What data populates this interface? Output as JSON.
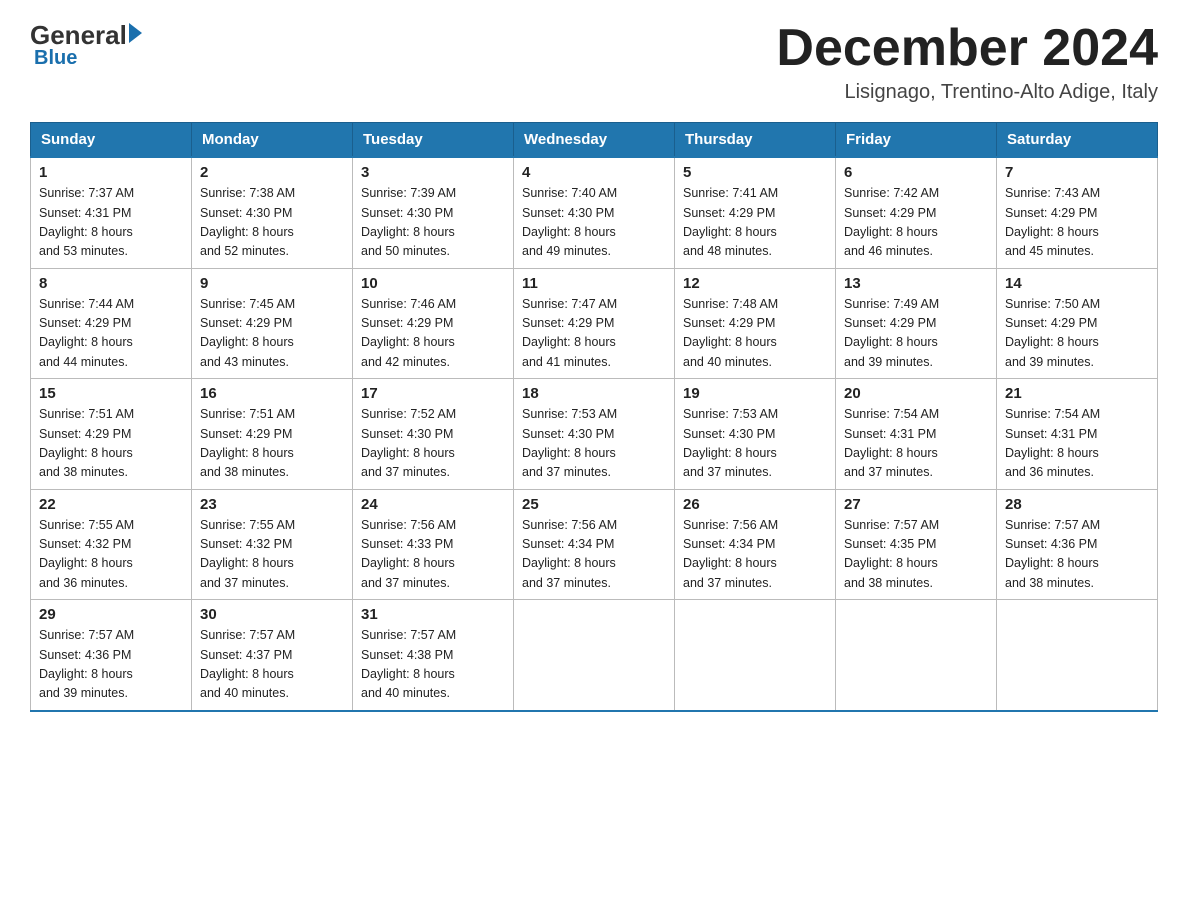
{
  "header": {
    "logo_general": "General",
    "logo_blue": "Blue",
    "title": "December 2024",
    "subtitle": "Lisignago, Trentino-Alto Adige, Italy"
  },
  "days_of_week": [
    "Sunday",
    "Monday",
    "Tuesday",
    "Wednesday",
    "Thursday",
    "Friday",
    "Saturday"
  ],
  "weeks": [
    [
      {
        "date": "1",
        "sunrise": "7:37 AM",
        "sunset": "4:31 PM",
        "daylight": "8 hours and 53 minutes."
      },
      {
        "date": "2",
        "sunrise": "7:38 AM",
        "sunset": "4:30 PM",
        "daylight": "8 hours and 52 minutes."
      },
      {
        "date": "3",
        "sunrise": "7:39 AM",
        "sunset": "4:30 PM",
        "daylight": "8 hours and 50 minutes."
      },
      {
        "date": "4",
        "sunrise": "7:40 AM",
        "sunset": "4:30 PM",
        "daylight": "8 hours and 49 minutes."
      },
      {
        "date": "5",
        "sunrise": "7:41 AM",
        "sunset": "4:29 PM",
        "daylight": "8 hours and 48 minutes."
      },
      {
        "date": "6",
        "sunrise": "7:42 AM",
        "sunset": "4:29 PM",
        "daylight": "8 hours and 46 minutes."
      },
      {
        "date": "7",
        "sunrise": "7:43 AM",
        "sunset": "4:29 PM",
        "daylight": "8 hours and 45 minutes."
      }
    ],
    [
      {
        "date": "8",
        "sunrise": "7:44 AM",
        "sunset": "4:29 PM",
        "daylight": "8 hours and 44 minutes."
      },
      {
        "date": "9",
        "sunrise": "7:45 AM",
        "sunset": "4:29 PM",
        "daylight": "8 hours and 43 minutes."
      },
      {
        "date": "10",
        "sunrise": "7:46 AM",
        "sunset": "4:29 PM",
        "daylight": "8 hours and 42 minutes."
      },
      {
        "date": "11",
        "sunrise": "7:47 AM",
        "sunset": "4:29 PM",
        "daylight": "8 hours and 41 minutes."
      },
      {
        "date": "12",
        "sunrise": "7:48 AM",
        "sunset": "4:29 PM",
        "daylight": "8 hours and 40 minutes."
      },
      {
        "date": "13",
        "sunrise": "7:49 AM",
        "sunset": "4:29 PM",
        "daylight": "8 hours and 39 minutes."
      },
      {
        "date": "14",
        "sunrise": "7:50 AM",
        "sunset": "4:29 PM",
        "daylight": "8 hours and 39 minutes."
      }
    ],
    [
      {
        "date": "15",
        "sunrise": "7:51 AM",
        "sunset": "4:29 PM",
        "daylight": "8 hours and 38 minutes."
      },
      {
        "date": "16",
        "sunrise": "7:51 AM",
        "sunset": "4:29 PM",
        "daylight": "8 hours and 38 minutes."
      },
      {
        "date": "17",
        "sunrise": "7:52 AM",
        "sunset": "4:30 PM",
        "daylight": "8 hours and 37 minutes."
      },
      {
        "date": "18",
        "sunrise": "7:53 AM",
        "sunset": "4:30 PM",
        "daylight": "8 hours and 37 minutes."
      },
      {
        "date": "19",
        "sunrise": "7:53 AM",
        "sunset": "4:30 PM",
        "daylight": "8 hours and 37 minutes."
      },
      {
        "date": "20",
        "sunrise": "7:54 AM",
        "sunset": "4:31 PM",
        "daylight": "8 hours and 37 minutes."
      },
      {
        "date": "21",
        "sunrise": "7:54 AM",
        "sunset": "4:31 PM",
        "daylight": "8 hours and 36 minutes."
      }
    ],
    [
      {
        "date": "22",
        "sunrise": "7:55 AM",
        "sunset": "4:32 PM",
        "daylight": "8 hours and 36 minutes."
      },
      {
        "date": "23",
        "sunrise": "7:55 AM",
        "sunset": "4:32 PM",
        "daylight": "8 hours and 37 minutes."
      },
      {
        "date": "24",
        "sunrise": "7:56 AM",
        "sunset": "4:33 PM",
        "daylight": "8 hours and 37 minutes."
      },
      {
        "date": "25",
        "sunrise": "7:56 AM",
        "sunset": "4:34 PM",
        "daylight": "8 hours and 37 minutes."
      },
      {
        "date": "26",
        "sunrise": "7:56 AM",
        "sunset": "4:34 PM",
        "daylight": "8 hours and 37 minutes."
      },
      {
        "date": "27",
        "sunrise": "7:57 AM",
        "sunset": "4:35 PM",
        "daylight": "8 hours and 38 minutes."
      },
      {
        "date": "28",
        "sunrise": "7:57 AM",
        "sunset": "4:36 PM",
        "daylight": "8 hours and 38 minutes."
      }
    ],
    [
      {
        "date": "29",
        "sunrise": "7:57 AM",
        "sunset": "4:36 PM",
        "daylight": "8 hours and 39 minutes."
      },
      {
        "date": "30",
        "sunrise": "7:57 AM",
        "sunset": "4:37 PM",
        "daylight": "8 hours and 40 minutes."
      },
      {
        "date": "31",
        "sunrise": "7:57 AM",
        "sunset": "4:38 PM",
        "daylight": "8 hours and 40 minutes."
      },
      null,
      null,
      null,
      null
    ]
  ],
  "labels": {
    "sunrise": "Sunrise:",
    "sunset": "Sunset:",
    "daylight": "Daylight:"
  }
}
